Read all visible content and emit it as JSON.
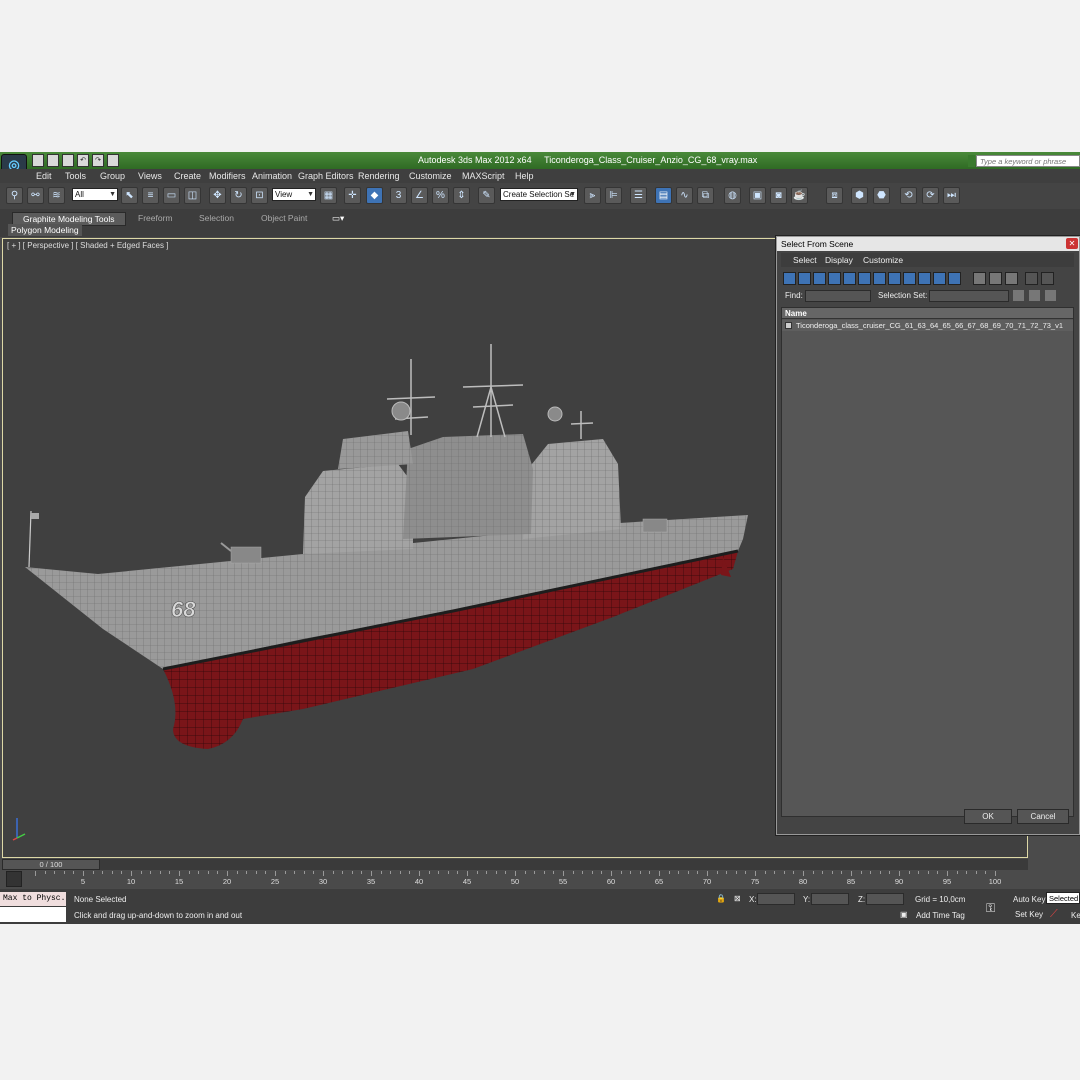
{
  "app": {
    "name": "Autodesk 3ds Max  2012 x64",
    "file": "Ticonderoga_Class_Cruiser_Anzio_CG_68_vray.max",
    "search_placeholder": "Type a keyword or phrase",
    "logo": "max-logo-icon"
  },
  "menu": [
    "Edit",
    "Tools",
    "Group",
    "Views",
    "Create",
    "Modifiers",
    "Animation",
    "Graph Editors",
    "Rendering",
    "Customize",
    "MAXScript",
    "Help"
  ],
  "toolbar": {
    "filter_value": "All",
    "coord_value": "View",
    "selection_set_value": "Create Selection Se"
  },
  "ribbon": {
    "tabs": [
      "Graphite Modeling Tools",
      "Freeform",
      "Selection",
      "Object Paint"
    ],
    "sub_label": "Polygon Modeling"
  },
  "viewport": {
    "label": "[ + ] [ Perspective ] [ Shaded + Edged Faces ]",
    "hull_number": "68",
    "hull_color": "#7a1519",
    "superstructure_color": "#9a9a9a"
  },
  "dialog": {
    "title": "Select From Scene",
    "menu": [
      "Select",
      "Display",
      "Customize"
    ],
    "find_label": "Find:",
    "selection_set_label": "Selection Set:",
    "column_header": "Name",
    "items": [
      "Ticonderoga_class_cruiser_CG_61_63_64_65_66_67_68_69_70_71_72_73_v1"
    ],
    "ok_label": "OK",
    "cancel_label": "Cancel"
  },
  "timeline": {
    "slider_label": "0 / 100",
    "ticks": [
      "5",
      "10",
      "15",
      "20",
      "25",
      "30",
      "35",
      "40",
      "45",
      "50",
      "55",
      "60",
      "65",
      "70",
      "75",
      "80",
      "85",
      "90",
      "95",
      "100"
    ]
  },
  "status": {
    "maxscript_label": "Max to Physc.",
    "selection_status": "None Selected",
    "prompt": "Click and drag up-and-down to zoom in and out",
    "x_label": "X:",
    "y_label": "Y:",
    "z_label": "Z:",
    "grid": "Grid = 10,0cm",
    "add_time_tag": "Add Time Tag",
    "auto_key": "Auto Key",
    "set_key": "Set Key",
    "selected_value": "Selected",
    "key_filter_partial": "Ke"
  }
}
